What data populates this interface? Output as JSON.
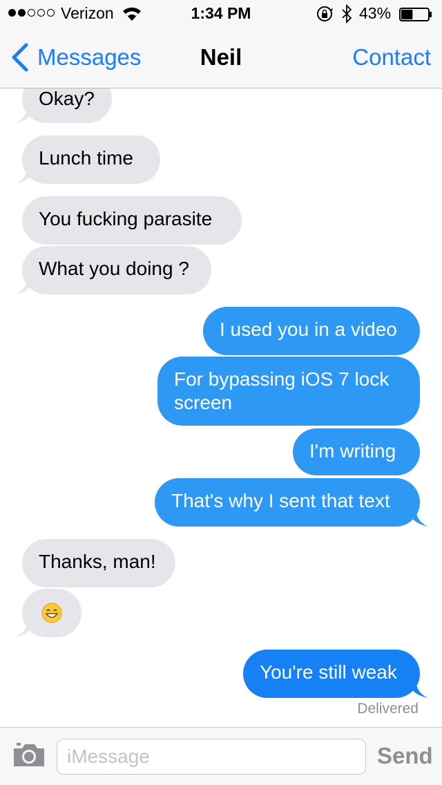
{
  "status_bar": {
    "carrier": "Verizon",
    "signal_bars": 2,
    "signal_total": 5,
    "time": "1:34 PM",
    "battery_percent": "43%",
    "battery_level": 0.43
  },
  "nav": {
    "back_label": "Messages",
    "title": "Neil",
    "contact_label": "Contact"
  },
  "messages": [
    {
      "sender": "them",
      "text": "Okay?"
    },
    {
      "sender": "them",
      "text": "Lunch time"
    },
    {
      "sender": "them",
      "text": "You fucking parasite"
    },
    {
      "sender": "them",
      "text": "What you doing ?"
    },
    {
      "sender": "me",
      "text": "I used you in a video"
    },
    {
      "sender": "me",
      "text": "For bypassing iOS 7 lock screen"
    },
    {
      "sender": "me",
      "text": "I'm writing"
    },
    {
      "sender": "me",
      "text": "That's why I sent that text"
    },
    {
      "sender": "them",
      "text": "Thanks, man!"
    },
    {
      "sender": "them",
      "emoji": "grinning-face-icon"
    },
    {
      "sender": "me",
      "text": "You're still weak"
    }
  ],
  "delivered_label": "Delivered",
  "input": {
    "placeholder": "iMessage",
    "value": "",
    "send_label": "Send"
  },
  "colors": {
    "accent": "#1a7ff5",
    "incoming_bubble": "#e6e5ea",
    "outgoing_bubble": "#2e99f5",
    "outgoing_bubble_latest": "#1680f5"
  }
}
